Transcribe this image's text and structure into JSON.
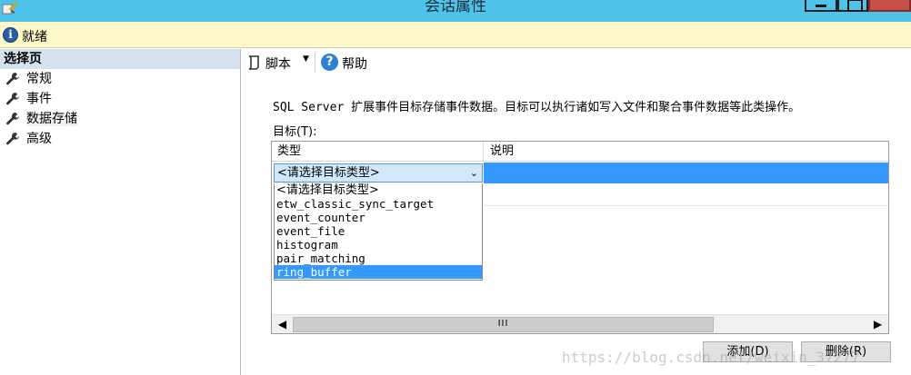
{
  "window": {
    "title": "会话属性"
  },
  "status": {
    "text": "就绪"
  },
  "left_panel": {
    "header": "选择页",
    "items": [
      {
        "label": "常规",
        "icon": "wrench-icon"
      },
      {
        "label": "事件",
        "icon": "wrench-icon"
      },
      {
        "label": "数据存储",
        "icon": "wrench-icon",
        "selected": true
      },
      {
        "label": "高级",
        "icon": "wrench-icon"
      }
    ]
  },
  "toolbar": {
    "script_label": "脚本",
    "help_label": "帮助"
  },
  "content": {
    "description": "SQL Server 扩展事件目标存储事件数据。目标可以执行诸如写入文件和聚合事件数据等此类操作。",
    "target_label": "目标(T):"
  },
  "grid": {
    "columns": [
      "类型",
      "说明"
    ],
    "combo_value": "<请选择目标类型>",
    "dropdown_options": [
      "<请选择目标类型>",
      "etw_classic_sync_target",
      "event_counter",
      "event_file",
      "histogram",
      "pair_matching",
      "ring_buffer"
    ],
    "selected_option": "ring_buffer",
    "scroll_thumb": "III"
  },
  "buttons": {
    "add": "添加(D)",
    "remove": "删除(R)"
  },
  "watermark": "https://blog.csdn.net/weixin_37277"
}
